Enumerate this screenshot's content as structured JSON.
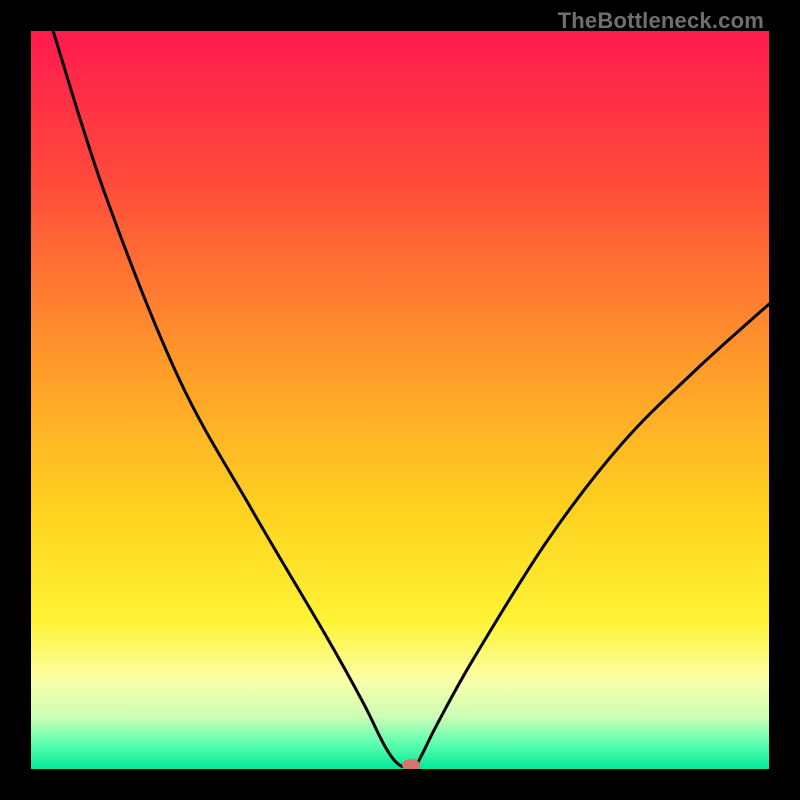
{
  "watermark": "TheBottleneck.com",
  "chart_data": {
    "type": "line",
    "title": "",
    "xlabel": "",
    "ylabel": "",
    "xlim": [
      0,
      100
    ],
    "ylim": [
      0,
      100
    ],
    "grid": false,
    "legend": false,
    "series": [
      {
        "name": "bottleneck-curve",
        "x": [
          3,
          10,
          20,
          30,
          40,
          45,
          48,
          50,
          52,
          53,
          55,
          60,
          70,
          80,
          90,
          100
        ],
        "y": [
          100,
          78,
          53,
          35,
          18,
          9,
          3,
          0.5,
          0.5,
          2,
          6,
          15,
          31,
          44,
          54,
          63
        ]
      }
    ],
    "marker": {
      "x": 51.5,
      "y": 0.5,
      "color": "#d9736a"
    },
    "background_gradient": {
      "stops": [
        {
          "offset": 0.0,
          "color": "#ff1a4f"
        },
        {
          "offset": 0.2,
          "color": "#ff4a3b"
        },
        {
          "offset": 0.45,
          "color": "#ff9a2a"
        },
        {
          "offset": 0.65,
          "color": "#ffd21f"
        },
        {
          "offset": 0.8,
          "color": "#fff335"
        },
        {
          "offset": 0.88,
          "color": "#fbffa8"
        },
        {
          "offset": 0.93,
          "color": "#c9ffb5"
        },
        {
          "offset": 0.965,
          "color": "#5fffb0"
        },
        {
          "offset": 1.0,
          "color": "#00e998"
        }
      ]
    }
  }
}
